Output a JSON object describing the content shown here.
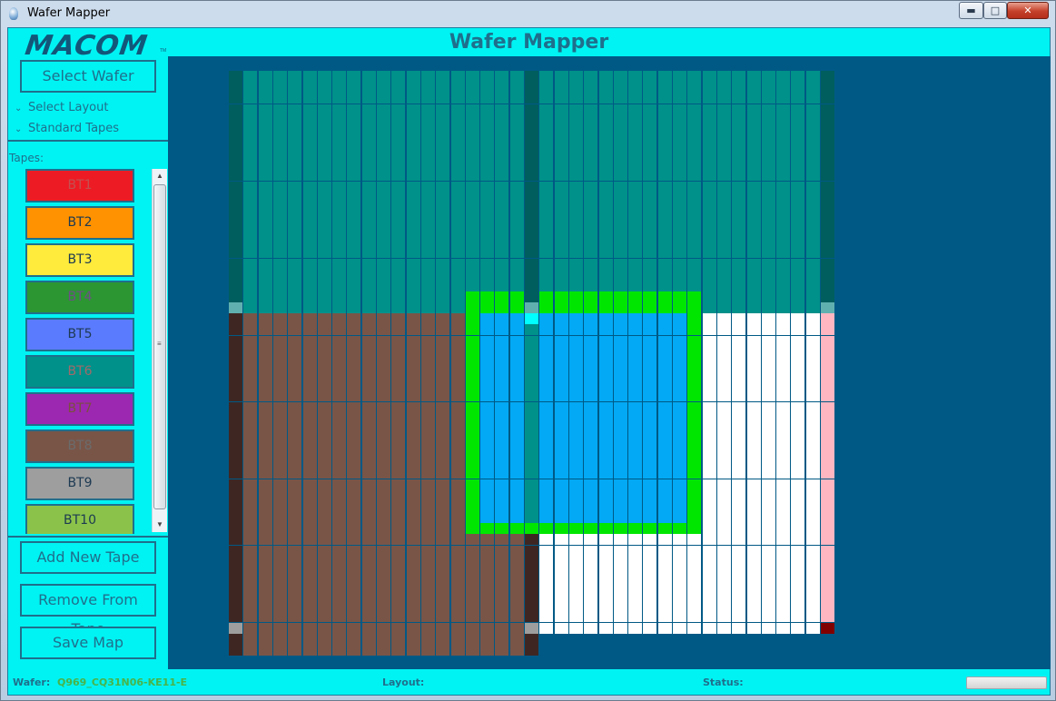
{
  "window": {
    "title": "Wafer Mapper",
    "minimize": "▬",
    "maximize": "□",
    "close": "✕"
  },
  "brand": {
    "logo": "MACOM",
    "tm": "TM"
  },
  "header": {
    "title": "Wafer Mapper"
  },
  "sidebar": {
    "select_wafer": "Select Wafer",
    "select_layout": "Select Layout",
    "standard_tapes": "Standard Tapes",
    "tapes_label": "Tapes:",
    "tapes": [
      {
        "label": "BT1",
        "color": "#ed1c24",
        "text_color": "#c45050"
      },
      {
        "label": "BT2",
        "color": "#ff9200",
        "text_color": "#1d3a52"
      },
      {
        "label": "BT3",
        "color": "#ffeb3b",
        "text_color": "#1d3a52"
      },
      {
        "label": "BT4",
        "color": "#2c9632",
        "text_color": "#6e4f87"
      },
      {
        "label": "BT5",
        "color": "#5b7bff",
        "text_color": "#1d3a52"
      },
      {
        "label": "BT6",
        "color": "#00918a",
        "text_color": "#a06a6a"
      },
      {
        "label": "BT7",
        "color": "#9c27b0",
        "text_color": "#7a5040"
      },
      {
        "label": "BT8",
        "color": "#795548",
        "text_color": "#6b6b6b"
      },
      {
        "label": "BT9",
        "color": "#9e9e9e",
        "text_color": "#1d3a52"
      },
      {
        "label": "BT10",
        "color": "#8bc34a",
        "text_color": "#1d3a52"
      }
    ],
    "add_new_tape": "Add New Tape",
    "remove_from_tape": "Remove From Tape",
    "save_map": "Save Map"
  },
  "wafer_map": {
    "columns": 41,
    "rows": 53,
    "colors": {
      "teal": "#00918a",
      "dark_teal": "#005e5e",
      "brown": "#795548",
      "dark_brown": "#3e2723",
      "blue": "#03a9f4",
      "green": "#00e600",
      "white": "#ffffff",
      "pink": "#ffb6c1",
      "light_teal": "#60b0b0",
      "cyan": "#00ffff",
      "gray": "#9e9e9e",
      "dark_red": "#800000",
      "background": "#005985"
    }
  },
  "statusbar": {
    "wafer_label": "Wafer:",
    "wafer_value": "Q969_CQ31N06-KE11-E",
    "layout_label": "Layout:",
    "status_label": "Status:"
  }
}
